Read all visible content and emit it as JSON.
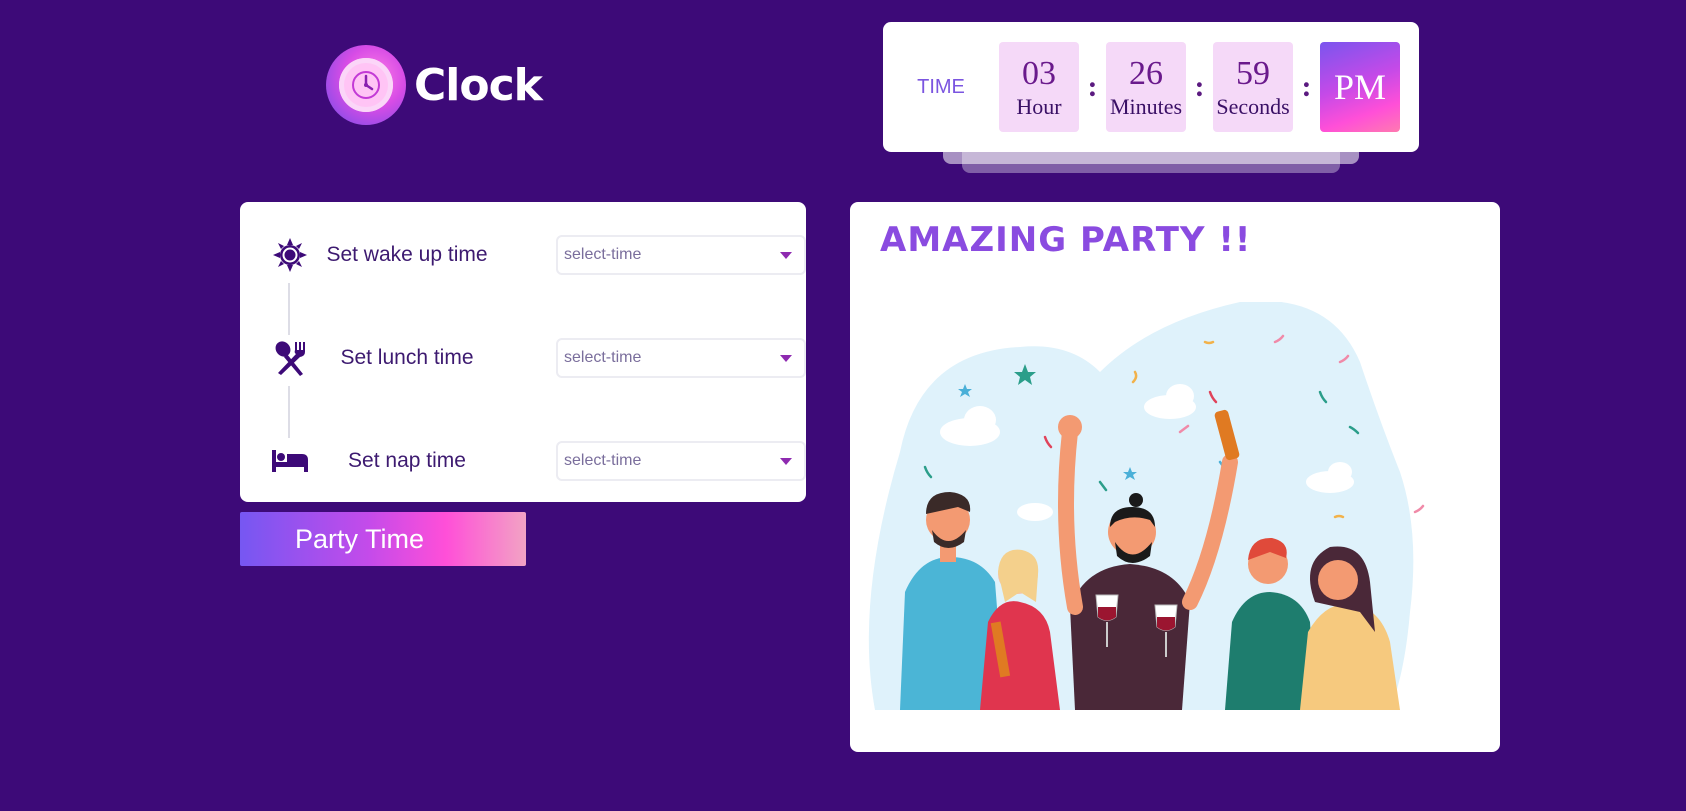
{
  "app": {
    "logo_text": "Clock"
  },
  "clock": {
    "label": "TIME",
    "hour": {
      "value": "03",
      "unit": "Hour"
    },
    "minutes": {
      "value": "26",
      "unit": "Minutes"
    },
    "seconds": {
      "value": "59",
      "unit": "Seconds"
    },
    "separator": ":",
    "ampm": "PM"
  },
  "schedule": {
    "items": [
      {
        "label": "Set wake up time",
        "icon": "sun-icon",
        "select_value": "select-time"
      },
      {
        "label": "Set lunch time",
        "icon": "utensils-icon",
        "select_value": "select-time"
      },
      {
        "label": "Set nap time",
        "icon": "bed-icon",
        "select_value": "select-time"
      }
    ],
    "button_label": "Party Time"
  },
  "party": {
    "title": "AMAZING PARTY !!"
  },
  "colors": {
    "background": "#3d0a78",
    "accent": "#8a4be0",
    "icon": "#3d0a78"
  }
}
